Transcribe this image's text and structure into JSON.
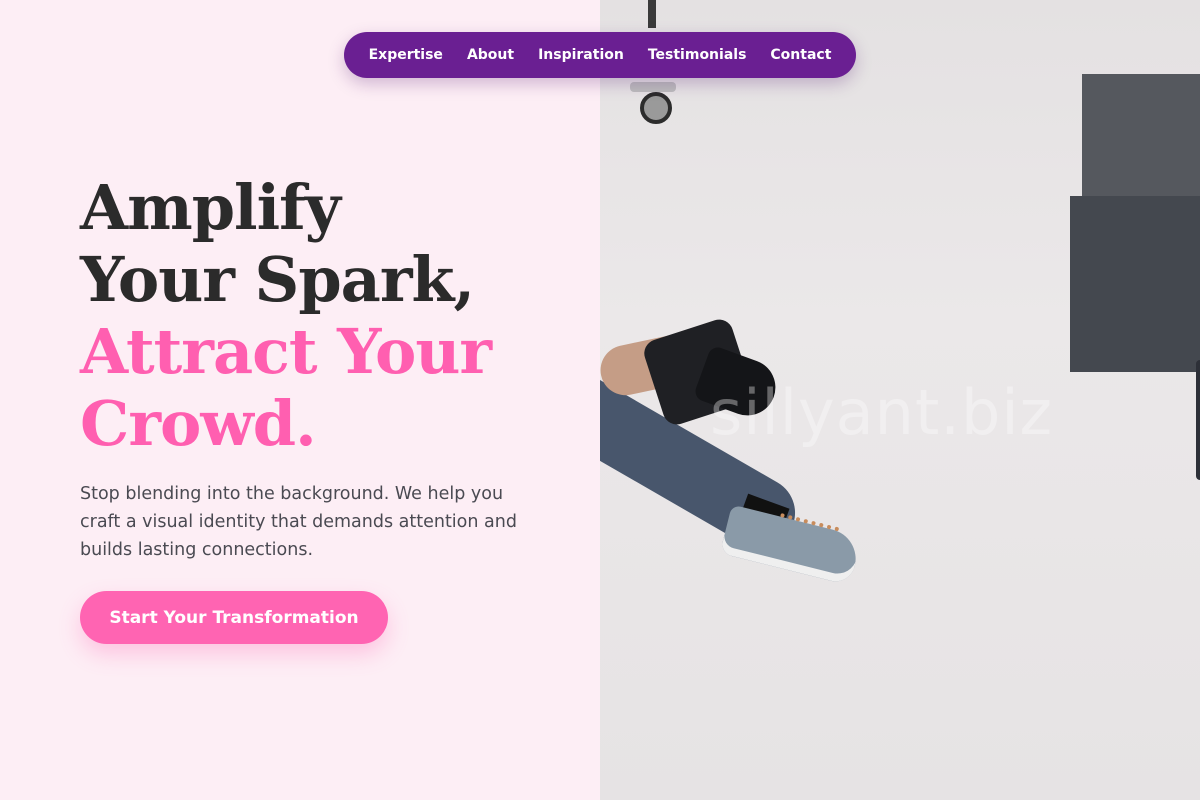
{
  "nav": {
    "items": [
      {
        "label": "Expertise"
      },
      {
        "label": "About"
      },
      {
        "label": "Inspiration"
      },
      {
        "label": "Testimonials"
      },
      {
        "label": "Contact"
      }
    ]
  },
  "hero": {
    "headline_line1": "Amplify",
    "headline_line2": "Your Spark,",
    "headline_accent_line1": "Attract Your",
    "headline_accent_line2": "Crowd.",
    "subtext": "Stop blending into the background. We help you craft a visual identity that demands attention and builds lasting connections.",
    "cta_label": "Start Your Transformation"
  },
  "photo": {
    "watermark": "sillyant.biz"
  },
  "colors": {
    "background": "#fdeef5",
    "nav": "#6a1f92",
    "accent_pink": "#ff64b2",
    "heading_dark": "#2b2b2b"
  }
}
